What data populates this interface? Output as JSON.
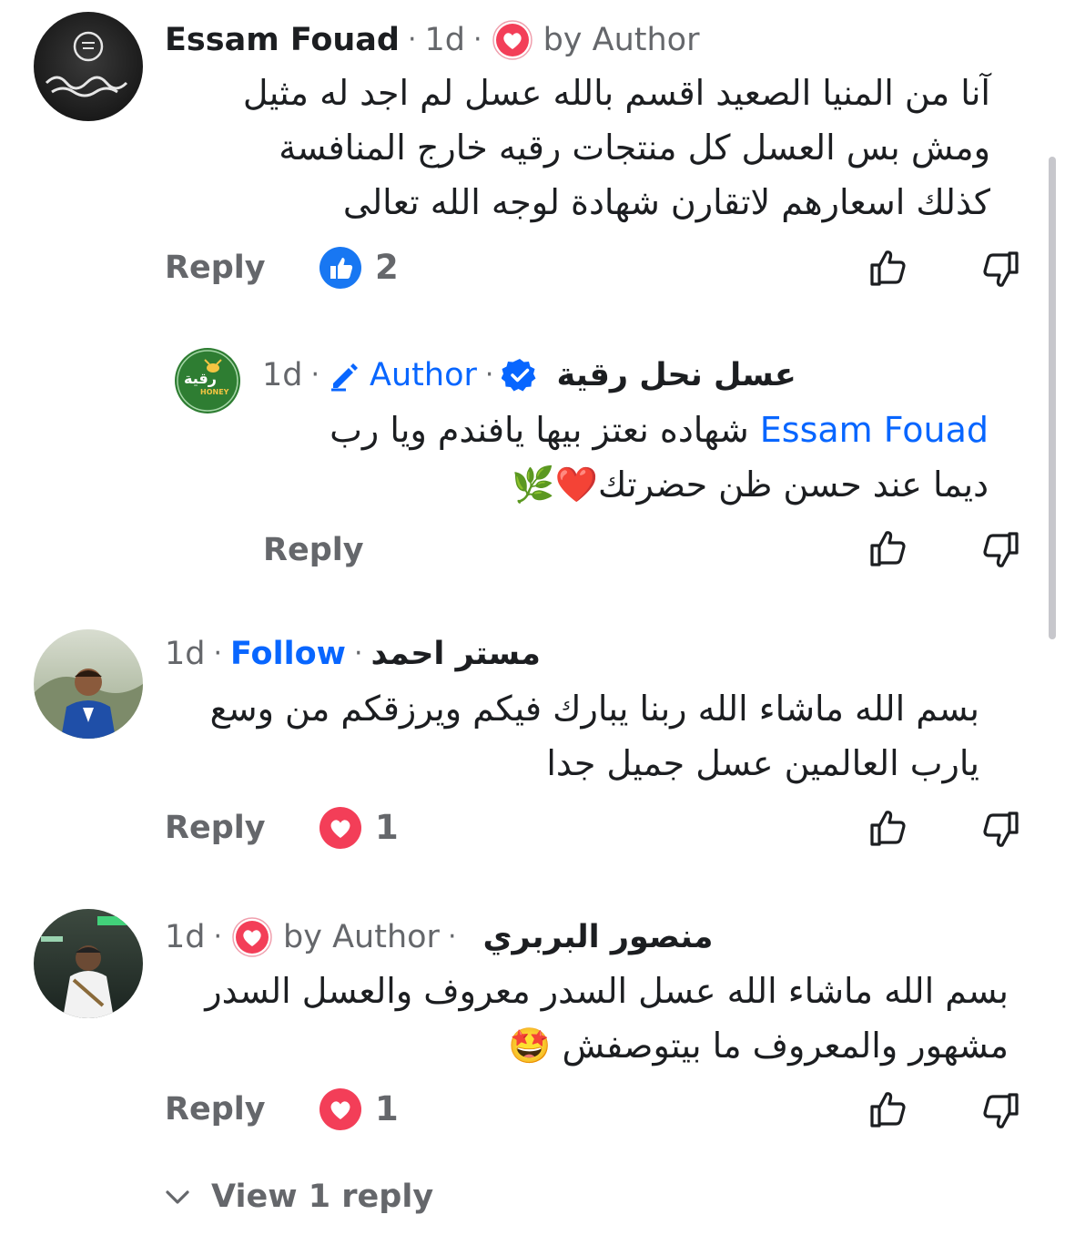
{
  "comments": [
    {
      "name": "Essam Fouad",
      "time": "1d",
      "badge": "by Author",
      "text_lines": [
        "آنا من المنيا الصعيد اقسم بالله عسل لم اجد له مثيل",
        "ومش بس العسل كل منتجات رقيه خارج المنافسة",
        "كذلك اسعارهم لاتقارن شهادة لوجه الله تعالى"
      ],
      "reply_label": "Reply",
      "reaction_count": "2",
      "reaction_type": "like"
    },
    {
      "name": "عسل نحل رقية",
      "time": "1d",
      "badge": "Author",
      "verified": true,
      "mention": "Essam Fouad",
      "text_line1_rest": "شهاده نعتز بيها يافندم ويا رب",
      "text_line2": "ديما عند حسن ظن حضرتك❤️🌿",
      "reply_label": "Reply",
      "avatar_text": "رقية",
      "avatar_subtext": "HONEY"
    },
    {
      "name": "مستر احمد",
      "time": "1d",
      "follow_label": "Follow",
      "text_lines": [
        "بسم الله ماشاء الله ربنا يبارك فيكم ويرزقكم من وسع",
        "يارب العالمين عسل جميل جدا"
      ],
      "reply_label": "Reply",
      "reaction_count": "1",
      "reaction_type": "love"
    },
    {
      "name": "منصور البربري",
      "time": "1d",
      "badge": "by Author",
      "text_lines": [
        "بسم الله ماشاء الله عسل السدر معروف والعسل السدر",
        "مشهور والمعروف ما بيتوصفش 🤩"
      ],
      "reply_label": "Reply",
      "reaction_count": "1",
      "reaction_type": "love"
    }
  ],
  "view_replies_label": "View 1 reply",
  "colors": {
    "link_blue": "#0866ff",
    "muted": "#65676b",
    "love_red": "#f33e58",
    "green_avatar": "#2e7d32"
  }
}
